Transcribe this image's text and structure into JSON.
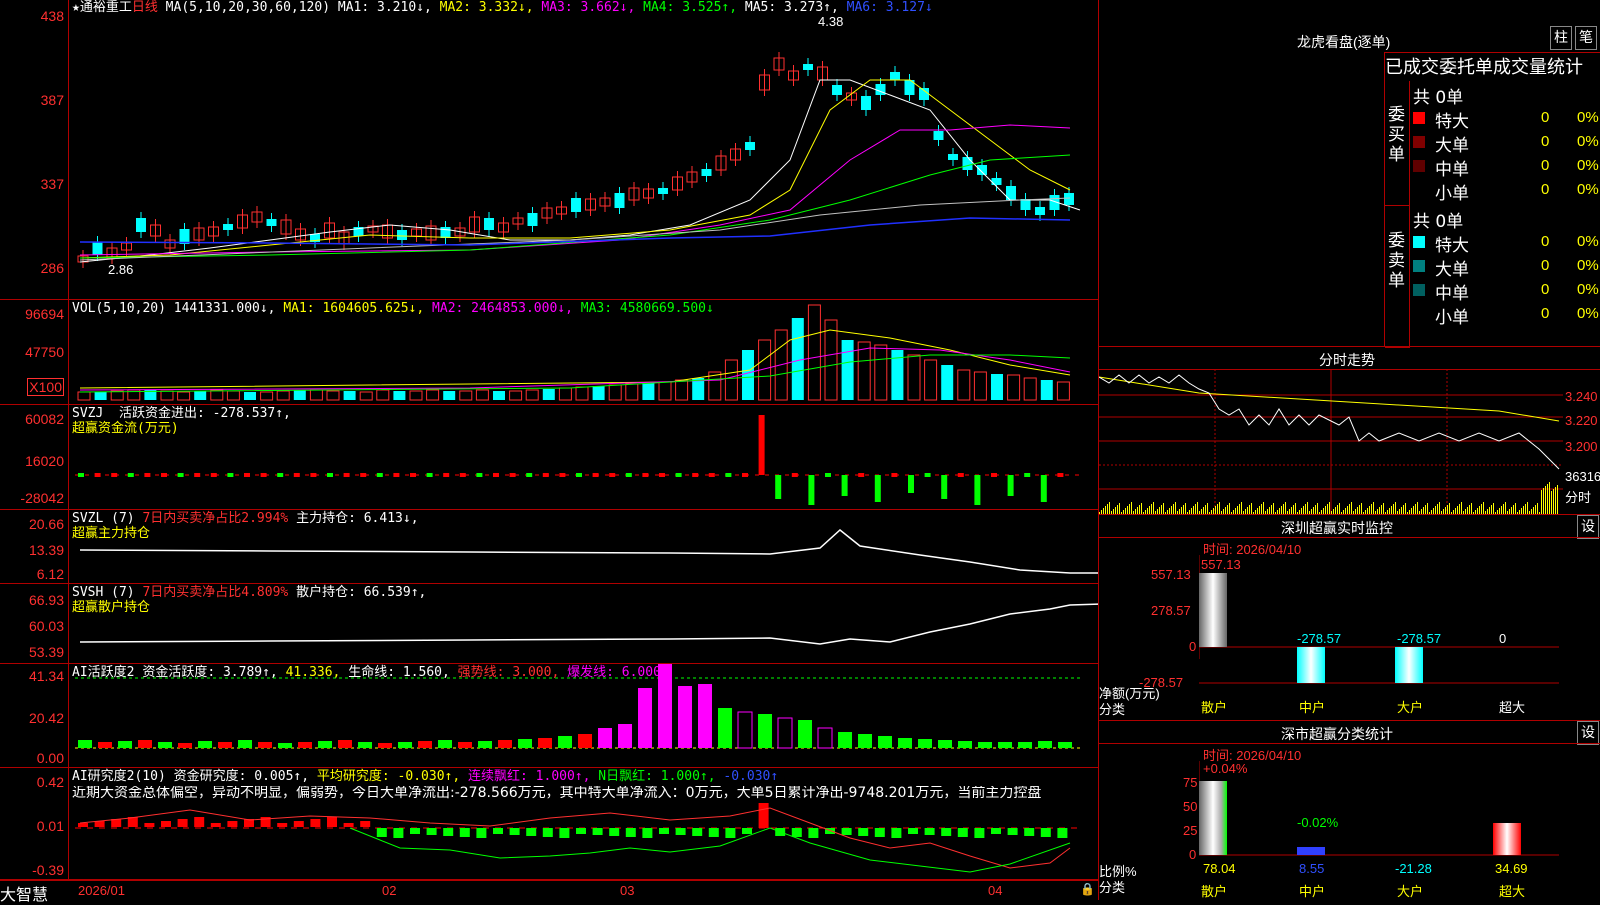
{
  "main": {
    "title": "★通裕重工",
    "period": "日线",
    "ma_label": "MA(5,10,20,30,60,120)",
    "ma": [
      {
        "text": "MA1: 3.210↓,",
        "color": "#ffffff"
      },
      {
        "text": "MA2: 3.332↓,",
        "color": "#ffff00"
      },
      {
        "text": "MA3: 3.662↓,",
        "color": "#ff00ff"
      },
      {
        "text": "MA4: 3.525↑,",
        "color": "#00ff00"
      },
      {
        "text": "MA5: 3.273↑,",
        "color": "#ffffff"
      },
      {
        "text": "MA6: 3.127↓",
        "color": "#0000ff"
      }
    ],
    "yticks": [
      "438",
      "387",
      "337",
      "286"
    ],
    "high_label": "4.38",
    "low_label": "2.86"
  },
  "vol": {
    "label": "VOL(5,10,20)",
    "value": "1441331.000↓,",
    "ma1": "MA1: 1604605.625↓,",
    "ma2": "MA2: 2464853.000↓,",
    "ma3": "MA3: 4580669.500↓",
    "yticks": [
      "96694",
      "47750"
    ],
    "unit": "X100"
  },
  "svzj": {
    "label": "SVZJ",
    "text": "活跃资金进出: -278.537↑,",
    "title": "超赢资金流(万元)",
    "yticks": [
      "60082",
      "16020",
      "-28042"
    ]
  },
  "svzl": {
    "label": "SVZL (7)",
    "text1": "7日内买卖净占比2.994%",
    "text2": "主力持仓: 6.413↓,",
    "title": "超赢主力持仓",
    "yticks": [
      "20.66",
      "13.39",
      "6.12"
    ]
  },
  "svsh": {
    "label": "SVSH (7)",
    "text1": "7日内买卖净占比4.809%",
    "text2": "散户持仓: 66.539↑,",
    "title": "超赢散户持仓",
    "yticks": [
      "66.93",
      "60.03",
      "53.39"
    ]
  },
  "ai1": {
    "label": "AI活跃度2",
    "t1": "资金活跃度: 3.789↑,",
    "t2": "41.336,",
    "t3": "生命线: 1.560,",
    "t4": "强势线: 3.000,",
    "t5": "爆发线: 6.000,",
    "yticks": [
      "41.34",
      "20.42",
      "0.00"
    ]
  },
  "ai2": {
    "label": "AI研究度2(10)",
    "t1": "资金研究度: 0.005↑,",
    "t2": "平均研究度: -0.030↑,",
    "t3": "连续飘红: 1.000↑,",
    "t4": "N日飘红: 1.000↑,",
    "t5": "-0.030↑",
    "comment": "近期大资金总体偏空，异动不明显，偏弱势，今日大单净流出:-278.566万元，其中特大单净流入：0万元，大单5日累计净出-9748.201万元，当前主力控盘",
    "yticks": [
      "0.42",
      "0.01",
      "-0.39"
    ]
  },
  "bottom": {
    "brand": "大智慧",
    "dates": [
      "2026/01",
      "02",
      "03",
      "04"
    ]
  },
  "dragon": {
    "title": "龙虎看盘(逐单)",
    "btn_zhu": "柱",
    "btn_bi": "笔",
    "subtitle": "已成交委托单成交量统计",
    "buy_label": "委买单",
    "sell_label": "委卖单",
    "buy_total": "共 0单",
    "sell_total": "共 0单",
    "buy_rows": [
      {
        "name": "特大",
        "n": "0",
        "p": "0%"
      },
      {
        "name": "大单",
        "n": "0",
        "p": "0%"
      },
      {
        "name": "中单",
        "n": "0",
        "p": "0%"
      },
      {
        "name": "小单",
        "n": "0",
        "p": "0%"
      }
    ],
    "sell_rows": [
      {
        "name": "特大",
        "n": "0",
        "p": "0%"
      },
      {
        "name": "大单",
        "n": "0",
        "p": "0%"
      },
      {
        "name": "中单",
        "n": "0",
        "p": "0%"
      },
      {
        "name": "小单",
        "n": "0",
        "p": "0%"
      }
    ]
  },
  "intraday": {
    "title": "分时走势",
    "prices": [
      "3.240",
      "3.220",
      "3.200"
    ],
    "vol": "36316",
    "unit": "分时"
  },
  "szmonitor": {
    "title": "深圳超赢实时监控",
    "btn": "设",
    "time": "时间: 2026/04/10",
    "yticks": [
      "557.13",
      "278.57",
      "0",
      "-278.57"
    ],
    "ylabel": "净额(万元)",
    "xlabel": "分类",
    "values": [
      "557.13",
      "-278.57",
      "-278.57",
      "0"
    ],
    "cats": [
      "散户",
      "中户",
      "大户",
      "超大"
    ]
  },
  "szstat": {
    "title": "深市超赢分类统计",
    "btn": "设",
    "time": "时间: 2026/04/10",
    "yticks": [
      "75",
      "50",
      "25",
      "0"
    ],
    "ylabel": "比例%",
    "xlabel": "分类",
    "top_labels": [
      "+0.04%",
      "-0.02%"
    ],
    "values": [
      "78.04",
      "8.55",
      "-21.28",
      "34.69"
    ],
    "cats": [
      "散户",
      "中户",
      "大户",
      "超大"
    ]
  }
}
